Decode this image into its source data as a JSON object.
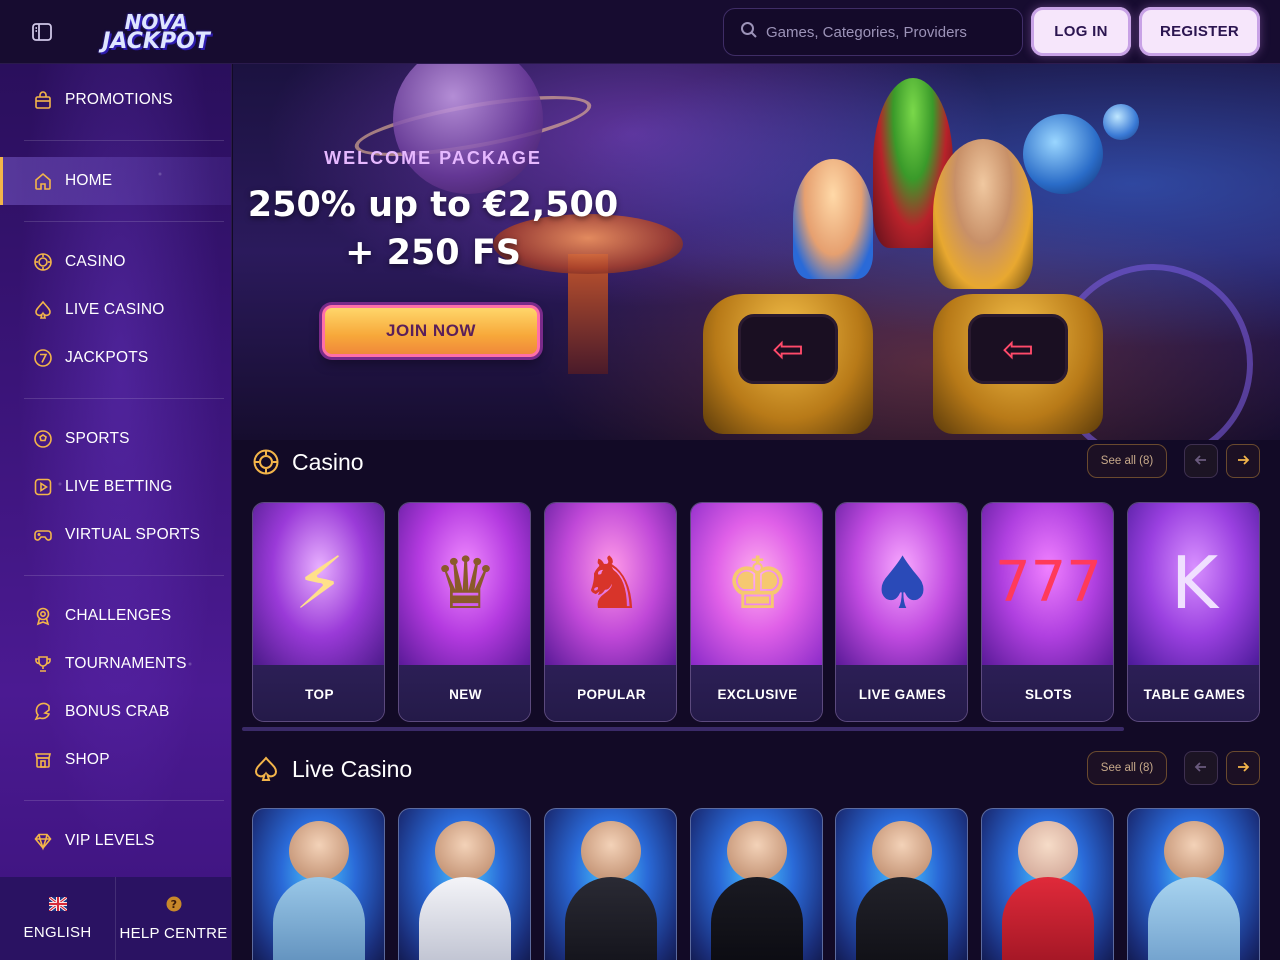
{
  "header": {
    "logo_line1": "NOVA",
    "logo_line2": "JACKPOT",
    "search_placeholder": "Games, Categories, Providers",
    "login_label": "LOG IN",
    "register_label": "REGISTER"
  },
  "sidebar": {
    "items": [
      {
        "label": "PROMOTIONS",
        "icon": "gift-bag-icon"
      },
      {
        "label": "HOME",
        "icon": "home-icon",
        "active": true
      },
      {
        "label": "CASINO",
        "icon": "casino-chip-icon"
      },
      {
        "label": "LIVE CASINO",
        "icon": "spade-icon"
      },
      {
        "label": "JACKPOTS",
        "icon": "seven-icon"
      },
      {
        "label": "SPORTS",
        "icon": "football-icon"
      },
      {
        "label": "LIVE BETTING",
        "icon": "play-icon"
      },
      {
        "label": "VIRTUAL SPORTS",
        "icon": "gamepad-icon"
      },
      {
        "label": "CHALLENGES",
        "icon": "medal-icon"
      },
      {
        "label": "TOURNAMENTS",
        "icon": "trophy-icon"
      },
      {
        "label": "BONUS CRAB",
        "icon": "crab-claw-icon"
      },
      {
        "label": "SHOP",
        "icon": "shop-icon"
      },
      {
        "label": "VIP LEVELS",
        "icon": "diamond-icon"
      }
    ],
    "footer": {
      "language_label": "ENGLISH",
      "help_label": "HELP CENTRE"
    }
  },
  "hero": {
    "eyebrow": "WELCOME PACKAGE",
    "title_line1": "250% up to €2,500",
    "title_line2": "+ 250 FS",
    "cta_label": "JOIN NOW"
  },
  "casino_section": {
    "title": "Casino",
    "see_all": "See all (8)",
    "cards": [
      {
        "label": "TOP"
      },
      {
        "label": "NEW"
      },
      {
        "label": "POPULAR"
      },
      {
        "label": "EXCLUSIVE"
      },
      {
        "label": "LIVE GAMES"
      },
      {
        "label": "SLOTS"
      },
      {
        "label": "TABLE GAMES"
      }
    ]
  },
  "live_casino_section": {
    "title": "Live Casino",
    "see_all": "See all (8)"
  },
  "colors": {
    "accent_gold": "#f3b54a",
    "background": "#120a26",
    "sidebar": "#3a1478",
    "cta_gradient_top": "#ffd66a"
  }
}
